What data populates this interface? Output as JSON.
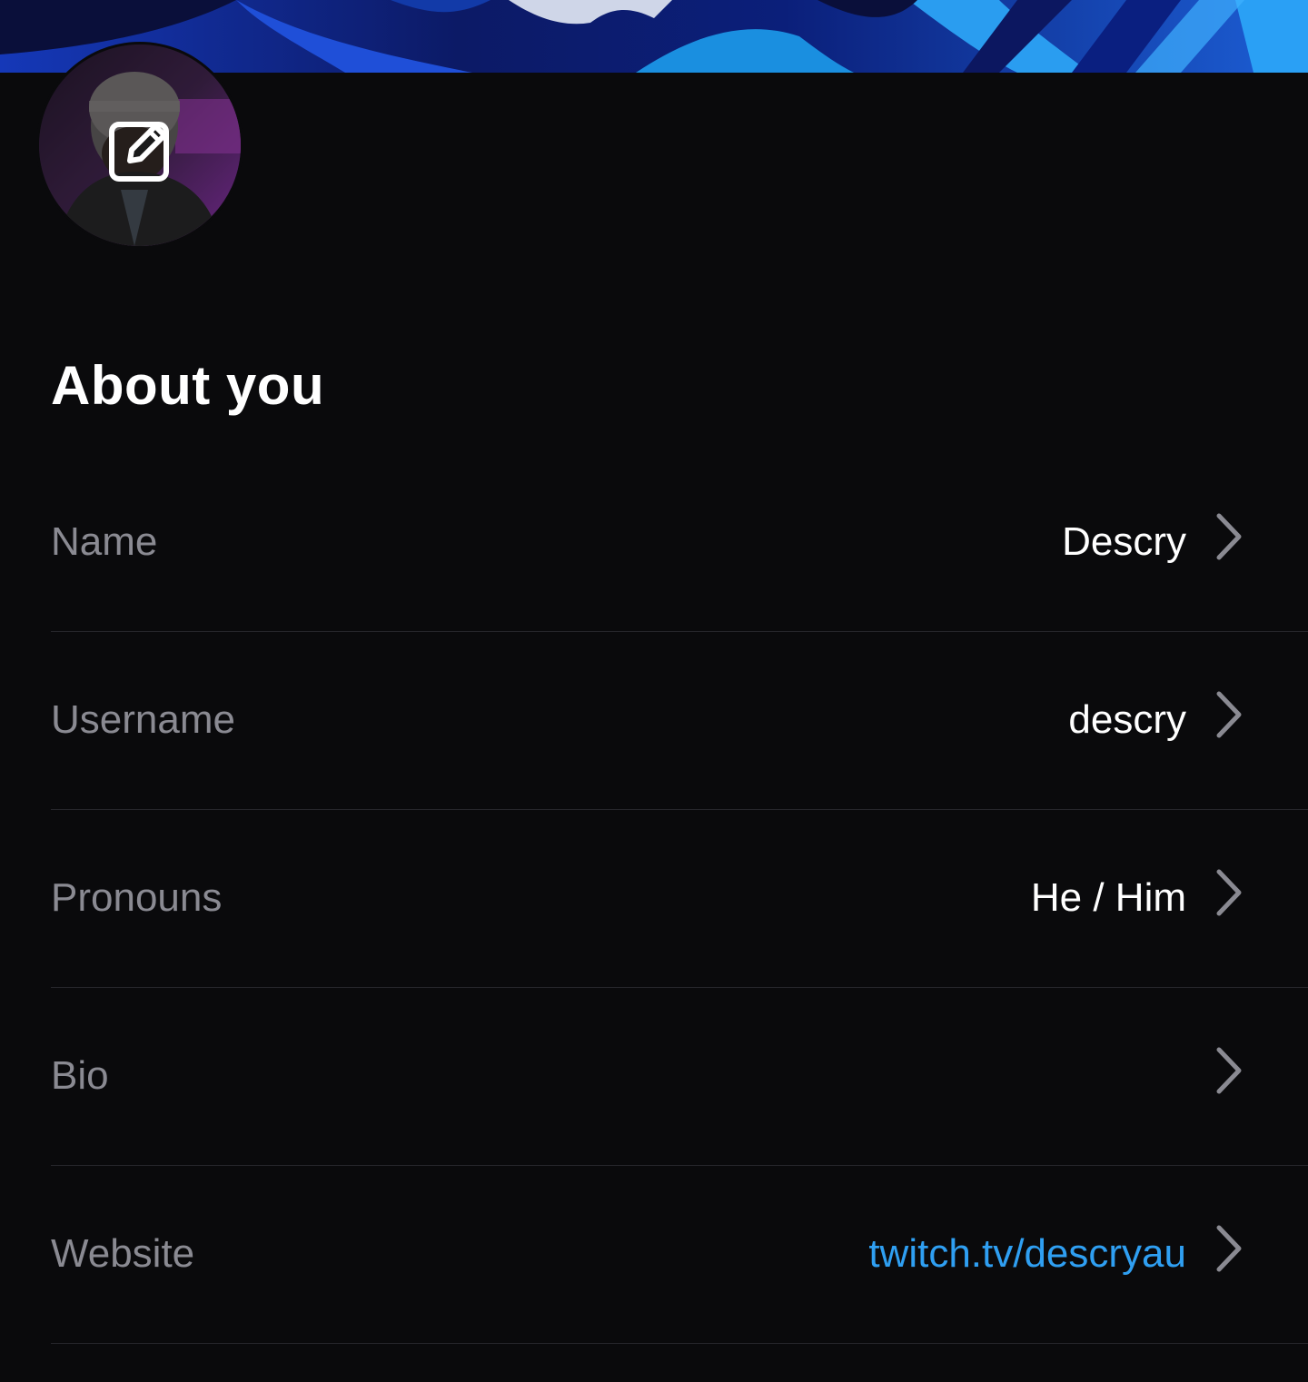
{
  "colors": {
    "background": "#0a0a0c",
    "label": "#8a8a92",
    "value": "#ffffff",
    "link": "#2f9ff2",
    "divider": "#26262b"
  },
  "profile": {
    "banner_image": "abstract-blue-banner",
    "avatar_image": "user-avatar-photo",
    "edit_icon": "edit-pencil-icon"
  },
  "section": {
    "title": "About you"
  },
  "fields": [
    {
      "label": "Name",
      "value": "Descry",
      "style": "text",
      "icon": "chevron-right-icon"
    },
    {
      "label": "Username",
      "value": "descry",
      "style": "text",
      "icon": "chevron-right-icon"
    },
    {
      "label": "Pronouns",
      "value": "He / Him",
      "style": "text",
      "icon": "chevron-right-icon"
    },
    {
      "label": "Bio",
      "value": "",
      "style": "text",
      "icon": "chevron-right-icon"
    },
    {
      "label": "Website",
      "value": "twitch.tv/descryau",
      "style": "link",
      "icon": "chevron-right-icon"
    }
  ]
}
